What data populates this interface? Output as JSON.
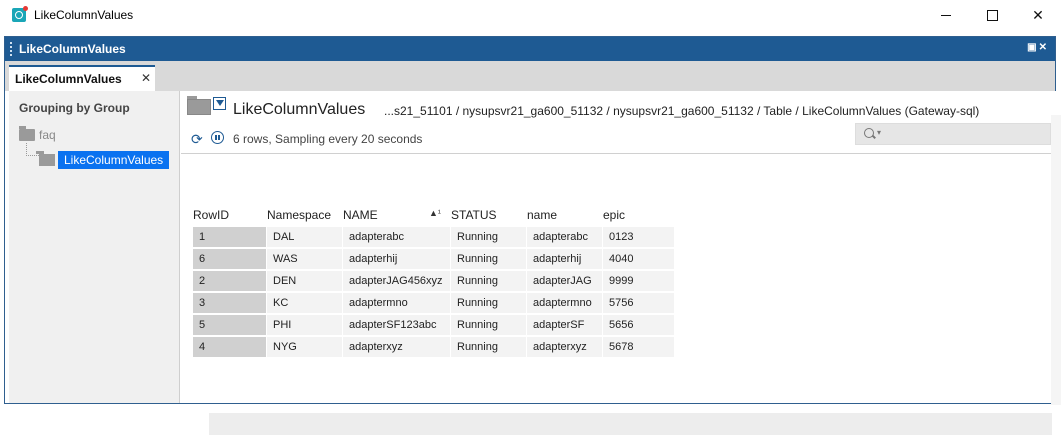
{
  "window": {
    "title": "LikeColumnValues",
    "minimize_glyph": "",
    "maximize_glyph": "",
    "close_glyph": "✕"
  },
  "panel": {
    "title": "LikeColumnValues",
    "controls": "▣✕"
  },
  "tab": {
    "label": "LikeColumnValues",
    "close": "✕"
  },
  "sidebar": {
    "heading": "Grouping by Group",
    "folder": {
      "label": "faq",
      "icon": "folder-icon"
    },
    "item": {
      "label": "LikeColumnValues",
      "icon": "table-icon"
    }
  },
  "main": {
    "title": "LikeColumnValues",
    "breadcrumb": "...s21_51101 / nysupsvr21_ga600_51132 / nysupsvr21_ga600_51132 / Table / LikeColumnValues (Gateway-sql)",
    "status": "6 rows, Sampling every 20 seconds",
    "search_placeholder": ""
  },
  "table": {
    "columns": [
      "RowID",
      "Namespace",
      "NAME",
      "STATUS",
      "name",
      "epic"
    ],
    "sort_indicator": "▲¹",
    "rows": [
      [
        "1",
        "DAL",
        "adapterabc",
        "Running",
        "adapterabc",
        "0123"
      ],
      [
        "6",
        "WAS",
        "adapterhij",
        "Running",
        "adapterhij",
        "4040"
      ],
      [
        "2",
        "DEN",
        "adapterJAG456xyz",
        "Running",
        "adapterJAG",
        "9999"
      ],
      [
        "3",
        "KC",
        "adaptermno",
        "Running",
        "adaptermno",
        "5756"
      ],
      [
        "5",
        "PHI",
        "adapterSF123abc",
        "Running",
        "adapterSF",
        "5656"
      ],
      [
        "4",
        "NYG",
        "adapterxyz",
        "Running",
        "adapterxyz",
        "5678"
      ]
    ]
  },
  "colors": {
    "accent": "#1e5a93",
    "selection": "#0a72f0"
  }
}
